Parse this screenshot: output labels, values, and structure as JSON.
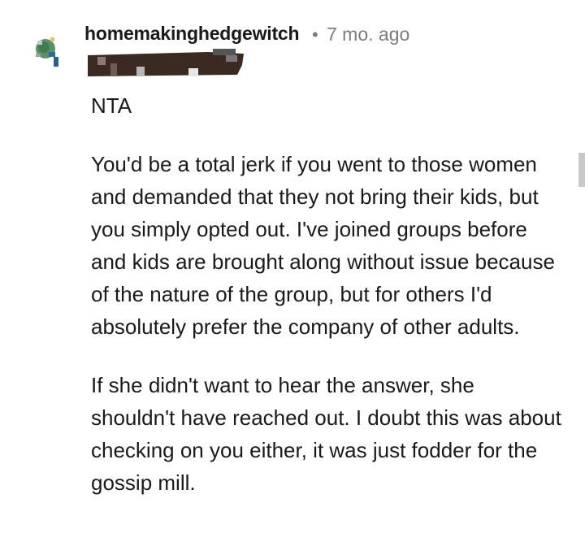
{
  "comment": {
    "author": "homemakinghedgewitch",
    "separator": "•",
    "timestamp": "7 mo. ago",
    "body": {
      "verdict": "NTA",
      "paragraph_1": "You'd be a total jerk if you went to those women and demanded that they not bring their kids, but you simply opted out. I've joined groups before and kids are brought along without issue because of the nature of the group, but for others I'd absolutely prefer the company of other adults.",
      "paragraph_2": "If she didn't want to hear the answer, she shouldn't have reached out. I doubt this was about checking on you either, it was just fodder for the gossip mill."
    }
  },
  "icons": {
    "avatar": "user-avatar-icon",
    "flair": "redacted-flair"
  },
  "colors": {
    "text": "#1a1a1b",
    "meta": "#7c7c7c",
    "scrollbar": "#c9c9c9",
    "avatar_green": "#3f7d4f",
    "flair_dark": "#3a2a22"
  }
}
